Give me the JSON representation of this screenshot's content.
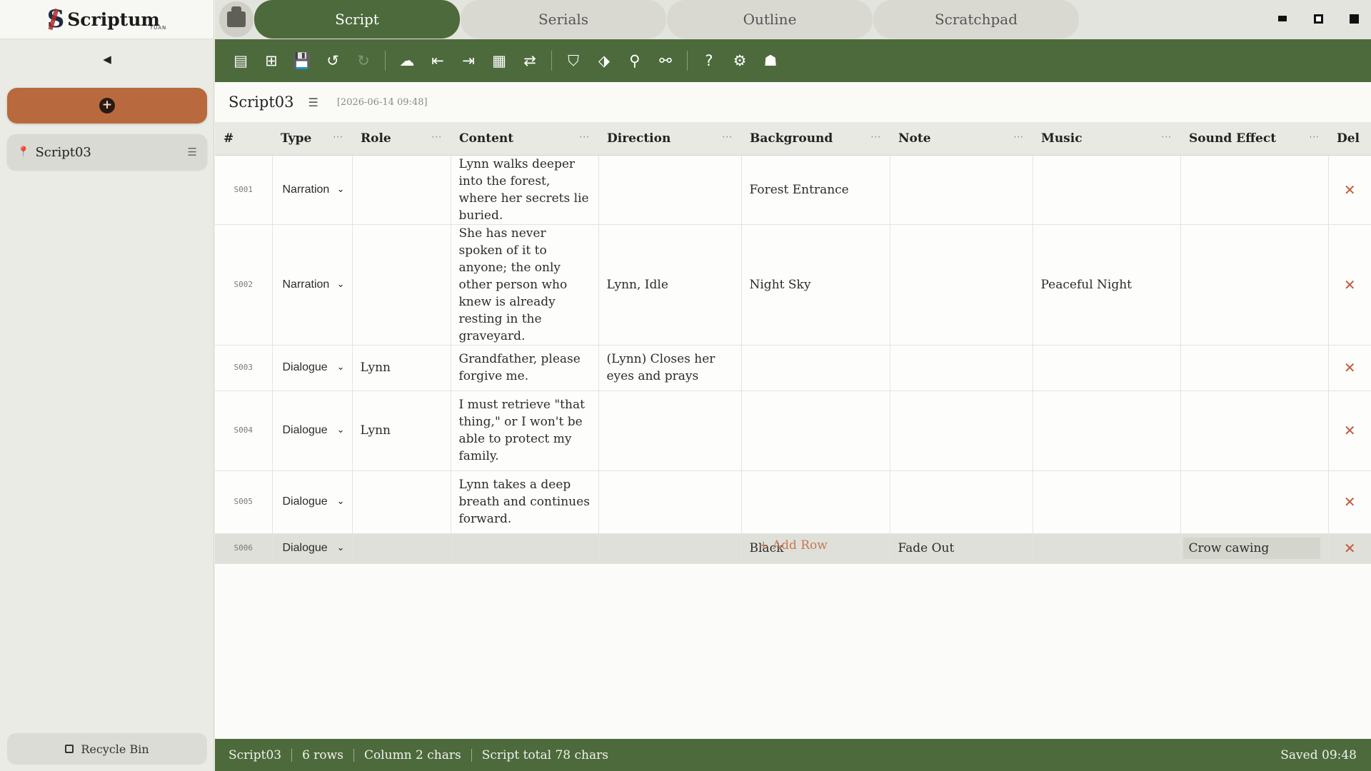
{
  "app": {
    "logo_name": "Scriptum",
    "logo_sub": "TUAN",
    "logo_mark": "S"
  },
  "sidebar": {
    "collapse_glyph": "◀",
    "new_glyph": "+",
    "scripts": [
      {
        "label": "Script03"
      }
    ],
    "recycle_label": "Recycle Bin"
  },
  "tabs": [
    {
      "label": "Script",
      "active": true
    },
    {
      "label": "Serials",
      "active": false
    },
    {
      "label": "Outline",
      "active": false
    },
    {
      "label": "Scratchpad",
      "active": false
    }
  ],
  "toolbar": {
    "icons": [
      {
        "name": "new-scene-icon",
        "glyph": "▤",
        "enabled": true
      },
      {
        "name": "insert-row-icon",
        "glyph": "⊞",
        "enabled": true
      },
      {
        "name": "save-icon",
        "glyph": "💾",
        "enabled": false
      },
      {
        "name": "undo-icon",
        "glyph": "↺",
        "enabled": true
      },
      {
        "name": "redo-icon",
        "glyph": "↻",
        "enabled": false
      },
      {
        "name": "cloud-icon",
        "glyph": "☁",
        "enabled": true
      },
      {
        "name": "import-icon",
        "glyph": "⇤",
        "enabled": true
      },
      {
        "name": "export-icon",
        "glyph": "⇥",
        "enabled": true
      },
      {
        "name": "excel-icon",
        "glyph": "▦",
        "enabled": true
      },
      {
        "name": "sync-icon",
        "glyph": "⇄",
        "enabled": true
      },
      {
        "name": "filter-icon",
        "glyph": "⛉",
        "enabled": true
      },
      {
        "name": "tag-icon",
        "glyph": "⬗",
        "enabled": true
      },
      {
        "name": "search-icon",
        "glyph": "⚲",
        "enabled": true
      },
      {
        "name": "replace-icon",
        "glyph": "⚯",
        "enabled": true
      },
      {
        "name": "help-icon",
        "glyph": "?",
        "enabled": true
      },
      {
        "name": "settings-icon",
        "glyph": "⚙",
        "enabled": true
      },
      {
        "name": "user-icon",
        "glyph": "☗",
        "enabled": true
      }
    ]
  },
  "document": {
    "title": "Script03",
    "timestamp": "[2026-06-14 09:48]"
  },
  "table": {
    "columns": [
      "#",
      "Type",
      "Role",
      "Content",
      "Direction",
      "Background",
      "Note",
      "Music",
      "Sound Effect",
      "Del"
    ],
    "rows": [
      {
        "id": "S001",
        "type": "Narration",
        "role": "",
        "content": "Lynn walks deeper into the forest, where her secrets lie buried.",
        "direction": "",
        "background": "Forest Entrance",
        "note": "",
        "music": "",
        "sfx": ""
      },
      {
        "id": "S002",
        "type": "Narration",
        "role": "",
        "content": "She has never spoken of it to anyone; the only other person who knew is already resting in the graveyard.",
        "direction": "Lynn, Idle",
        "background": "Night Sky",
        "note": "",
        "music": "Peaceful Night",
        "sfx": ""
      },
      {
        "id": "S003",
        "type": "Dialogue",
        "role": "Lynn",
        "content": "Grandfather, please forgive me.",
        "direction": "(Lynn) Closes her eyes and prays",
        "background": "",
        "note": "",
        "music": "",
        "sfx": ""
      },
      {
        "id": "S004",
        "type": "Dialogue",
        "role": "Lynn",
        "content": "I must retrieve \"that thing,\" or I won't be able to protect my family.",
        "direction": "",
        "background": "",
        "note": "",
        "music": "",
        "sfx": ""
      },
      {
        "id": "S005",
        "type": "Dialogue",
        "role": "",
        "content": "Lynn takes a deep breath and continues forward.",
        "direction": "",
        "background": "",
        "note": "",
        "music": "",
        "sfx": ""
      },
      {
        "id": "S006",
        "type": "Dialogue",
        "role": "",
        "content": "",
        "direction": "",
        "background": "Black",
        "note": "Fade Out",
        "music": "",
        "sfx": "Crow cawing"
      }
    ],
    "add_row_label": "+ Add Row",
    "delete_glyph": "✕"
  },
  "status": {
    "script": "Script03",
    "rows": "6 rows",
    "column_chars": "Column 2 chars",
    "total_chars": "Script total 78 chars",
    "saved": "Saved 09:48"
  },
  "colors": {
    "accent_green": "#4d6a3c",
    "accent_orange": "#b86a3e",
    "delete_red": "#c05a3a"
  }
}
